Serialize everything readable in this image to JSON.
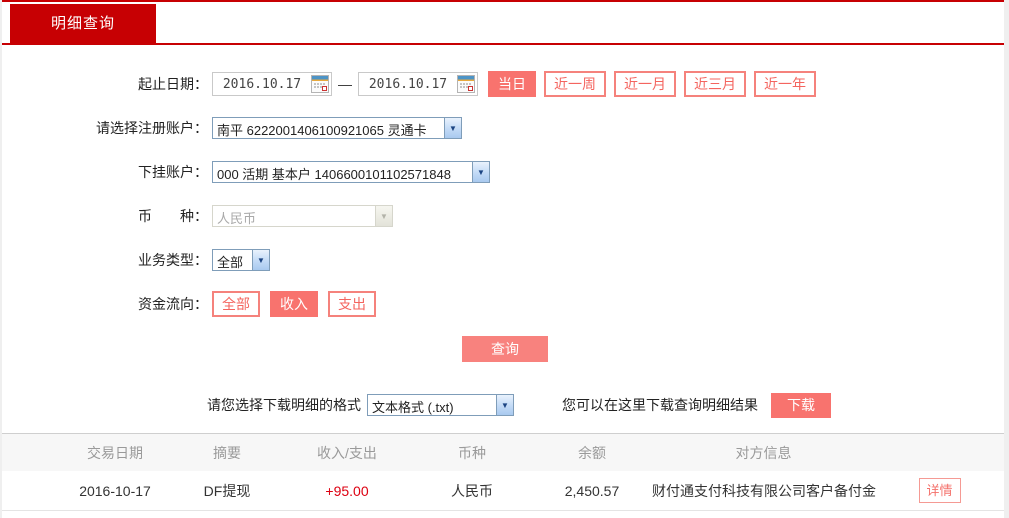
{
  "tab": {
    "title": "明细查询"
  },
  "form": {
    "date_row": {
      "label": "起止日期：",
      "start_date": "2016.10.17",
      "separator": "—",
      "end_date": "2016.10.17",
      "quick_buttons": [
        {
          "label": "当日",
          "active": true
        },
        {
          "label": "近一周",
          "active": false
        },
        {
          "label": "近一月",
          "active": false
        },
        {
          "label": "近三月",
          "active": false
        },
        {
          "label": "近一年",
          "active": false
        }
      ]
    },
    "register_account": {
      "label": "请选择注册账户：",
      "value": "南平 6222001406100921065 灵通卡"
    },
    "sub_account": {
      "label": "下挂账户：",
      "value": "000 活期 基本户 1406600101102571848"
    },
    "currency": {
      "label": "币　　种：",
      "value": "人民币",
      "disabled": true
    },
    "business_type": {
      "label": "业务类型：",
      "value": "全部"
    },
    "fund_flow": {
      "label": "资金流向：",
      "options": [
        {
          "label": "全部",
          "active": false
        },
        {
          "label": "收入",
          "active": true
        },
        {
          "label": "支出",
          "active": false
        }
      ]
    },
    "query_button": "查询"
  },
  "download": {
    "format_label": "请您选择下载明细的格式",
    "format_value": "文本格式 (.txt)",
    "hint": "您可以在这里下载查询明细结果",
    "button": "下载"
  },
  "table": {
    "headers": [
      "交易日期",
      "摘要",
      "收入/支出",
      "币种",
      "余额",
      "对方信息"
    ],
    "rows": [
      {
        "date": "2016-10-17",
        "summary": "DF提现",
        "amount": "+95.00",
        "currency": "人民币",
        "balance": "2,450.57",
        "counterparty": "财付通支付科技有限公司客户备付金",
        "detail_label": "详情"
      }
    ]
  },
  "colors": {
    "brand_red": "#c70003",
    "button_pink": "#f8736e",
    "button_pink_border": "#f5827c",
    "amount_red": "#dd0011",
    "header_text": "#9a9a9a",
    "select_border": "#7f9db9"
  }
}
